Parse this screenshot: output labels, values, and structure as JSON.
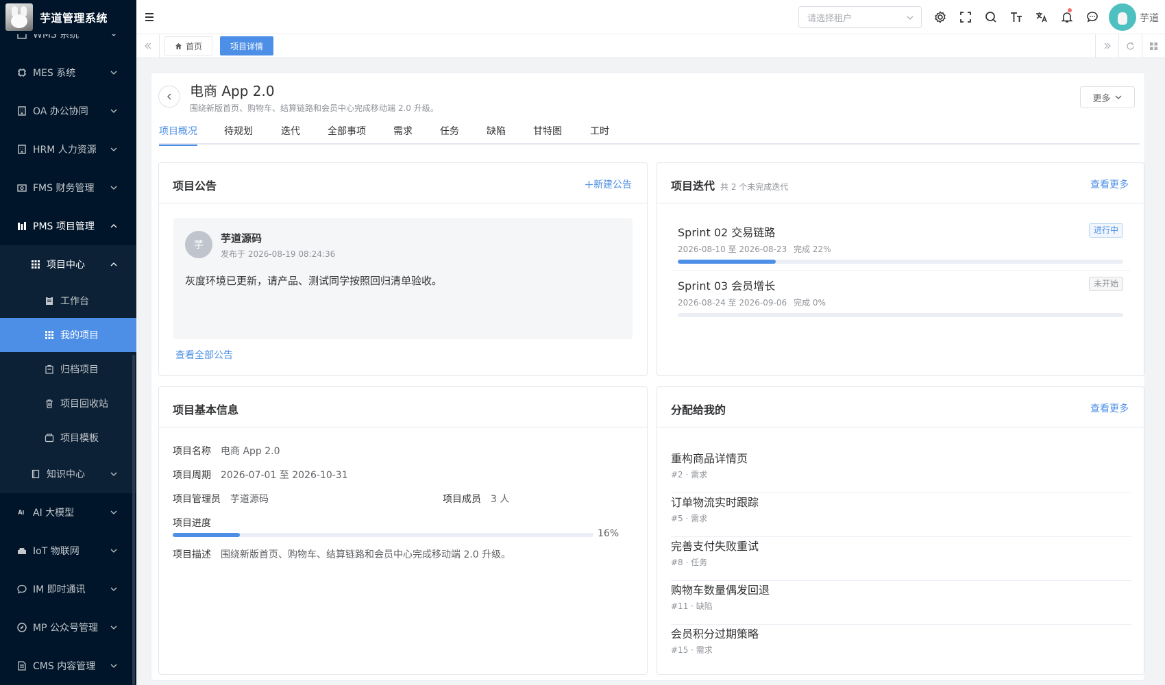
{
  "app": {
    "title": "芋道管理系统"
  },
  "sidebar": {
    "items": [
      {
        "label": "WMS 系统",
        "icon": "package-icon"
      },
      {
        "label": "MES 系统",
        "icon": "cpu-icon"
      },
      {
        "label": "OA 办公协同",
        "icon": "building-icon"
      },
      {
        "label": "HRM 人力资源",
        "icon": "building-icon"
      },
      {
        "label": "FMS 财务管理",
        "icon": "money-icon"
      },
      {
        "label": "PMS 项目管理",
        "icon": "project-icon"
      },
      {
        "label": "项目中心",
        "icon": "grid-icon"
      },
      {
        "label": "工作台",
        "icon": "clipboard-icon"
      },
      {
        "label": "我的项目",
        "icon": "grid-icon"
      },
      {
        "label": "归档项目",
        "icon": "archive-icon"
      },
      {
        "label": "项目回收站",
        "icon": "trash-icon"
      },
      {
        "label": "项目模板",
        "icon": "template-icon"
      },
      {
        "label": "知识中心",
        "icon": "book-icon"
      },
      {
        "label": "AI 大模型",
        "icon": "ai-icon"
      },
      {
        "label": "IoT 物联网",
        "icon": "iot-icon"
      },
      {
        "label": "IM 即时通讯",
        "icon": "chat-icon"
      },
      {
        "label": "MP 公众号管理",
        "icon": "compass-icon"
      },
      {
        "label": "CMS 内容管理",
        "icon": "document-icon"
      }
    ]
  },
  "header": {
    "tenant_placeholder": "请选择租户",
    "username": "芋道"
  },
  "tabsbar": {
    "tabs": [
      {
        "label": "首页",
        "active": false
      },
      {
        "label": "项目详情",
        "active": true
      }
    ]
  },
  "project": {
    "name": "电商 App 2.0",
    "description": "围绕新版首页、购物车、结算链路和会员中心完成移动端 2.0 升级。",
    "more_label": "更多",
    "tabs": [
      "项目概况",
      "待规划",
      "迭代",
      "全部事项",
      "需求",
      "任务",
      "缺陷",
      "甘特图",
      "工时"
    ]
  },
  "notice": {
    "title": "项目公告",
    "new_label": "新建公告",
    "avatar_char": "芋",
    "author": "芋道源码",
    "time": "发布于 2026-08-19 08:24:36",
    "body": "灰度环境已更新，请产品、测试同学按照回归清单验收。",
    "view_all": "查看全部公告"
  },
  "iterations": {
    "title": "项目迭代",
    "subtitle": "共 2 个未完成迭代",
    "link": "查看更多",
    "items": [
      {
        "name": "Sprint 02 交易链路",
        "dates": "2026-08-10 至 2026-08-23",
        "done": "完成 22%",
        "progress": 0.22,
        "status": "进行中",
        "status_color": "#4d8fe6"
      },
      {
        "name": "Sprint 03 会员增长",
        "dates": "2026-08-24 至 2026-09-06",
        "done": "完成 0%",
        "progress": 0,
        "status": "未开始",
        "status_color": "#909399"
      }
    ]
  },
  "basic": {
    "title": "项目基本信息",
    "name_label": "项目名称",
    "name_value": "电商 App 2.0",
    "period_label": "项目周期",
    "period_value": "2026-07-01 至 2026-10-31",
    "admin_label": "项目管理员",
    "admin_value": "芋道源码",
    "members_label": "项目成员",
    "members_value": "3 人",
    "progress_label": "项目进度",
    "progress_text": "16%",
    "progress": 0.16,
    "desc_label": "项目描述",
    "desc_value": "围绕新版首页、购物车、结算链路和会员中心完成移动端 2.0 升级。"
  },
  "assigned": {
    "title": "分配给我的",
    "link": "查看更多",
    "items": [
      {
        "title": "重构商品详情页",
        "meta": "#2 · 需求"
      },
      {
        "title": "订单物流实时跟踪",
        "meta": "#5 · 需求"
      },
      {
        "title": "完善支付失败重试",
        "meta": "#8 · 任务"
      },
      {
        "title": "购物车数量偶发回退",
        "meta": "#11 · 缺陷"
      },
      {
        "title": "会员积分过期策略",
        "meta": "#15 · 需求"
      }
    ]
  },
  "colors": {
    "accent": "#4d8fe6",
    "sidebar_bg": "#001529",
    "sidebar_active": "#4d8fe6"
  }
}
